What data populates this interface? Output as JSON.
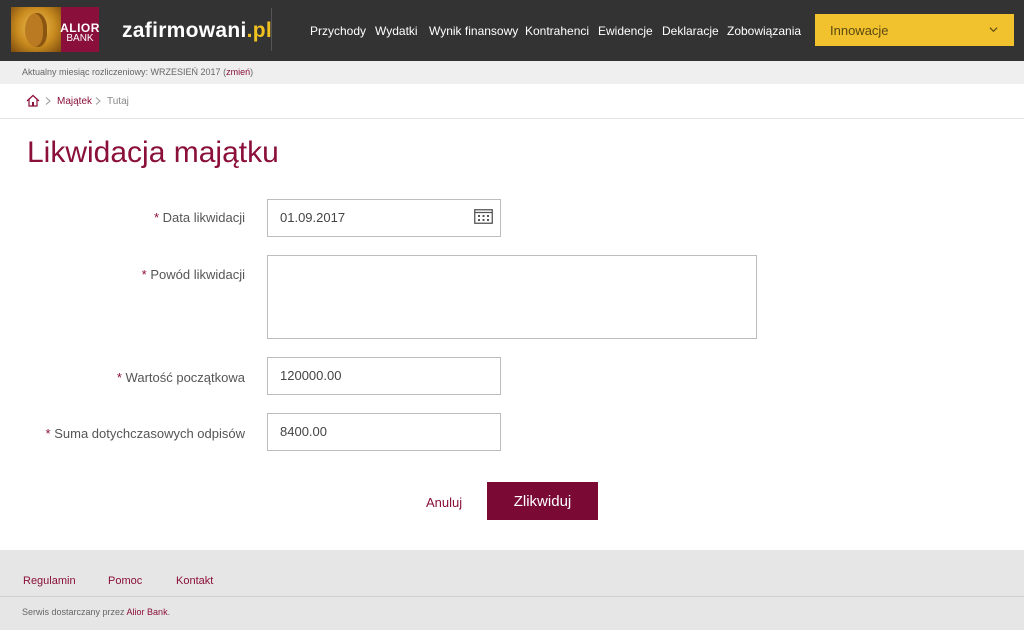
{
  "header": {
    "logo": {
      "line1": "ALIOR",
      "line2": "BANK"
    },
    "brand_main": "zafirmowani",
    "brand_suffix": ".pl",
    "nav": [
      "Przychody",
      "Wydatki",
      "Wynik finansowy",
      "Kontrahenci",
      "Ewidencje",
      "Deklaracje",
      "Zobowiązania"
    ],
    "dropdown_label": "Innowacje"
  },
  "subbar": {
    "text": "Aktualny miesiąc rozliczeniowy: WRZESIEŃ 2017",
    "open_paren": " (",
    "link": "zmień",
    "close_paren": ")"
  },
  "breadcrumb": {
    "home_icon": "home-icon",
    "link": "Majątek",
    "current": "Tutaj"
  },
  "page": {
    "title": "Likwidacja majątku"
  },
  "form": {
    "required_mark": "*",
    "date_label": "Data likwidacji",
    "date_value": "01.09.2017",
    "reason_label": "Powód likwidacji",
    "reason_value": "",
    "initial_value_label": "Wartość początkowa",
    "initial_value": "120000.00",
    "depreciation_label": "Suma dotychczasowych odpisów",
    "depreciation_value": "8400.00",
    "cancel_label": "Anuluj",
    "submit_label": "Zlikwiduj"
  },
  "footer": {
    "links": [
      "Regulamin",
      "Pomoc",
      "Kontakt"
    ],
    "note_prefix": "Serwis dostarczany przez ",
    "note_link": "Alior Bank",
    "note_suffix": "."
  },
  "colors": {
    "brand": "#8a0f3a",
    "header_bg": "#333333",
    "accent_yellow": "#f2c12e"
  }
}
